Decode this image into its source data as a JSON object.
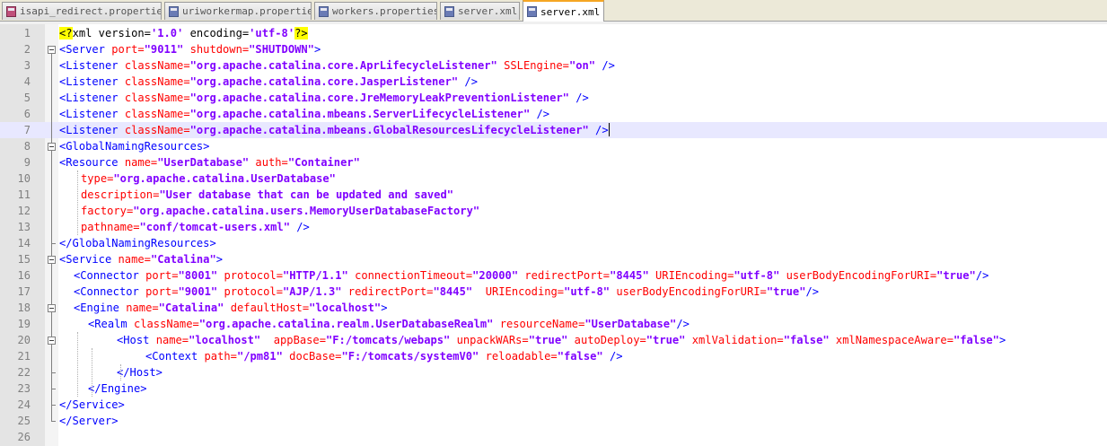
{
  "tabs": [
    {
      "label": "isapi_redirect.properties",
      "icon": "modified-file-icon",
      "active": false
    },
    {
      "label": "uriworkermap.properties",
      "icon": "file-icon",
      "active": false
    },
    {
      "label": "workers.properties",
      "icon": "file-icon",
      "active": false
    },
    {
      "label": "server.xml",
      "icon": "file-icon",
      "active": false
    },
    {
      "label": "server.xml",
      "icon": "file-icon",
      "active": true
    }
  ],
  "editor": {
    "current_line": 7,
    "lines": [
      {
        "n": "1",
        "fold": "none",
        "indent": 0,
        "tokens": [
          [
            "pi",
            "<?"
          ],
          [
            "piattr",
            "xml version="
          ],
          [
            "pival",
            "'1.0'"
          ],
          [
            "piattr",
            " encoding="
          ],
          [
            "pival",
            "'utf-8'"
          ],
          [
            "pi",
            "?>"
          ]
        ]
      },
      {
        "n": "2",
        "fold": "open",
        "indent": 0,
        "tokens": [
          [
            "tag",
            "<Server "
          ],
          [
            "attr",
            "port="
          ],
          [
            "val",
            "\"9011\""
          ],
          [
            "attr",
            " shutdown="
          ],
          [
            "val",
            "\"SHUTDOWN\""
          ],
          [
            "tag",
            ">"
          ]
        ]
      },
      {
        "n": "3",
        "fold": "line",
        "indent": 0,
        "tokens": [
          [
            "tag",
            "<Listener "
          ],
          [
            "attr",
            "className="
          ],
          [
            "val",
            "\"org.apache.catalina.core.AprLifecycleListener\""
          ],
          [
            "attr",
            " SSLEngine="
          ],
          [
            "val",
            "\"on\""
          ],
          [
            "tag",
            " />"
          ]
        ]
      },
      {
        "n": "4",
        "fold": "line",
        "indent": 0,
        "tokens": [
          [
            "tag",
            "<Listener "
          ],
          [
            "attr",
            "className="
          ],
          [
            "val",
            "\"org.apache.catalina.core.JasperListener\""
          ],
          [
            "tag",
            " />"
          ]
        ]
      },
      {
        "n": "5",
        "fold": "line",
        "indent": 0,
        "tokens": [
          [
            "tag",
            "<Listener "
          ],
          [
            "attr",
            "className="
          ],
          [
            "val",
            "\"org.apache.catalina.core.JreMemoryLeakPreventionListener\""
          ],
          [
            "tag",
            " />"
          ]
        ]
      },
      {
        "n": "6",
        "fold": "line",
        "indent": 0,
        "tokens": [
          [
            "tag",
            "<Listener "
          ],
          [
            "attr",
            "className="
          ],
          [
            "val",
            "\"org.apache.catalina.mbeans.ServerLifecycleListener\""
          ],
          [
            "tag",
            " />"
          ]
        ]
      },
      {
        "n": "7",
        "fold": "line",
        "indent": 0,
        "tokens": [
          [
            "tag",
            "<Listener "
          ],
          [
            "attr",
            "className="
          ],
          [
            "val",
            "\"org.apache.catalina.mbeans.GlobalResourcesLifecycleListener\""
          ],
          [
            "tag",
            " />"
          ]
        ],
        "caret": true
      },
      {
        "n": "8",
        "fold": "open",
        "indent": 0,
        "tokens": [
          [
            "tag",
            "<GlobalNamingResources>"
          ]
        ]
      },
      {
        "n": "9",
        "fold": "line",
        "indent": 0,
        "tokens": [
          [
            "tag",
            "<Resource "
          ],
          [
            "attr",
            "name="
          ],
          [
            "val",
            "\"UserDatabase\""
          ],
          [
            "attr",
            " auth="
          ],
          [
            "val",
            "\"Container\""
          ]
        ]
      },
      {
        "n": "10",
        "fold": "line",
        "indent": 3,
        "tokens": [
          [
            "attr",
            "type="
          ],
          [
            "val",
            "\"org.apache.catalina.UserDatabase\""
          ]
        ]
      },
      {
        "n": "11",
        "fold": "line",
        "indent": 3,
        "tokens": [
          [
            "attr",
            "description="
          ],
          [
            "val",
            "\"User database that can be updated and saved\""
          ]
        ]
      },
      {
        "n": "12",
        "fold": "line",
        "indent": 3,
        "tokens": [
          [
            "attr",
            "factory="
          ],
          [
            "val",
            "\"org.apache.catalina.users.MemoryUserDatabaseFactory\""
          ]
        ]
      },
      {
        "n": "13",
        "fold": "line",
        "indent": 3,
        "tokens": [
          [
            "attr",
            "pathname="
          ],
          [
            "val",
            "\"conf/tomcat-users.xml\""
          ],
          [
            "tag",
            " />"
          ]
        ]
      },
      {
        "n": "14",
        "fold": "end",
        "indent": 0,
        "tokens": [
          [
            "tag",
            "</GlobalNamingResources>"
          ]
        ]
      },
      {
        "n": "15",
        "fold": "open",
        "indent": 0,
        "tokens": [
          [
            "tag",
            "<Service "
          ],
          [
            "attr",
            "name="
          ],
          [
            "val",
            "\"Catalina\""
          ],
          [
            "tag",
            ">"
          ]
        ]
      },
      {
        "n": "16",
        "fold": "line",
        "indent": 2,
        "tokens": [
          [
            "tag",
            "<Connector "
          ],
          [
            "attr",
            "port="
          ],
          [
            "val",
            "\"8001\""
          ],
          [
            "attr",
            " protocol="
          ],
          [
            "val",
            "\"HTTP/1.1\""
          ],
          [
            "attr",
            " connectionTimeout="
          ],
          [
            "val",
            "\"20000\""
          ],
          [
            "attr",
            " redirectPort="
          ],
          [
            "val",
            "\"8445\""
          ],
          [
            "attr",
            " URIEncoding="
          ],
          [
            "val",
            "\"utf-8\""
          ],
          [
            "attr",
            " userBodyEncodingForURI="
          ],
          [
            "val",
            "\"true\""
          ],
          [
            "tag",
            "/>"
          ]
        ]
      },
      {
        "n": "17",
        "fold": "line",
        "indent": 2,
        "tokens": [
          [
            "tag",
            "<Connector "
          ],
          [
            "attr",
            "port="
          ],
          [
            "val",
            "\"9001\""
          ],
          [
            "attr",
            " protocol="
          ],
          [
            "val",
            "\"AJP/1.3\""
          ],
          [
            "attr",
            " redirectPort="
          ],
          [
            "val",
            "\"8445\""
          ],
          [
            "attr",
            "  URIEncoding="
          ],
          [
            "val",
            "\"utf-8\""
          ],
          [
            "attr",
            " userBodyEncodingForURI="
          ],
          [
            "val",
            "\"true\""
          ],
          [
            "tag",
            "/>"
          ]
        ]
      },
      {
        "n": "18",
        "fold": "open",
        "indent": 2,
        "tokens": [
          [
            "tag",
            "<Engine "
          ],
          [
            "attr",
            "name="
          ],
          [
            "val",
            "\"Catalina\""
          ],
          [
            "attr",
            " defaultHost="
          ],
          [
            "val",
            "\"localhost\""
          ],
          [
            "tag",
            ">"
          ]
        ]
      },
      {
        "n": "19",
        "fold": "line",
        "indent": 4,
        "tokens": [
          [
            "tag",
            "<Realm "
          ],
          [
            "attr",
            "className="
          ],
          [
            "val",
            "\"org.apache.catalina.realm.UserDatabaseRealm\""
          ],
          [
            "attr",
            " resourceName="
          ],
          [
            "val",
            "\"UserDatabase\""
          ],
          [
            "tag",
            "/>"
          ]
        ]
      },
      {
        "n": "20",
        "fold": "open",
        "indent": 8,
        "tokens": [
          [
            "tag",
            "<Host "
          ],
          [
            "attr",
            "name="
          ],
          [
            "val",
            "\"localhost\""
          ],
          [
            "attr",
            "  appBase="
          ],
          [
            "val",
            "\"F:/tomcats/webaps\""
          ],
          [
            "attr",
            " unpackWARs="
          ],
          [
            "val",
            "\"true\""
          ],
          [
            "attr",
            " autoDeploy="
          ],
          [
            "val",
            "\"true\""
          ],
          [
            "attr",
            " xmlValidation="
          ],
          [
            "val",
            "\"false\""
          ],
          [
            "attr",
            " xmlNamespaceAware="
          ],
          [
            "val",
            "\"false\""
          ],
          [
            "tag",
            ">"
          ]
        ]
      },
      {
        "n": "21",
        "fold": "line",
        "indent": 12,
        "tokens": [
          [
            "tag",
            "<Context "
          ],
          [
            "attr",
            "path="
          ],
          [
            "val",
            "\"/pm81\""
          ],
          [
            "attr",
            " docBase="
          ],
          [
            "val",
            "\"F:/tomcats/systemV0\""
          ],
          [
            "attr",
            " reloadable="
          ],
          [
            "val",
            "\"false\""
          ],
          [
            "tag",
            " />"
          ]
        ]
      },
      {
        "n": "22",
        "fold": "end",
        "indent": 8,
        "tokens": [
          [
            "tag",
            "</Host>"
          ]
        ]
      },
      {
        "n": "23",
        "fold": "end",
        "indent": 4,
        "tokens": [
          [
            "tag",
            "</Engine>"
          ]
        ]
      },
      {
        "n": "24",
        "fold": "end",
        "indent": 0,
        "tokens": [
          [
            "tag",
            "</Service>"
          ]
        ]
      },
      {
        "n": "25",
        "fold": "end",
        "indent": 0,
        "tokens": [
          [
            "tag",
            "</Server>"
          ]
        ]
      },
      {
        "n": "26",
        "fold": "none",
        "indent": 0,
        "tokens": []
      }
    ]
  },
  "colors": {
    "tag": "#0000ff",
    "attr": "#ff0000",
    "value": "#8000ff",
    "pi_highlight": "#ffff00",
    "current_line": "#e8e8ff",
    "margin": "#e4e4e4",
    "active_tab_accent": "#f5a623"
  }
}
